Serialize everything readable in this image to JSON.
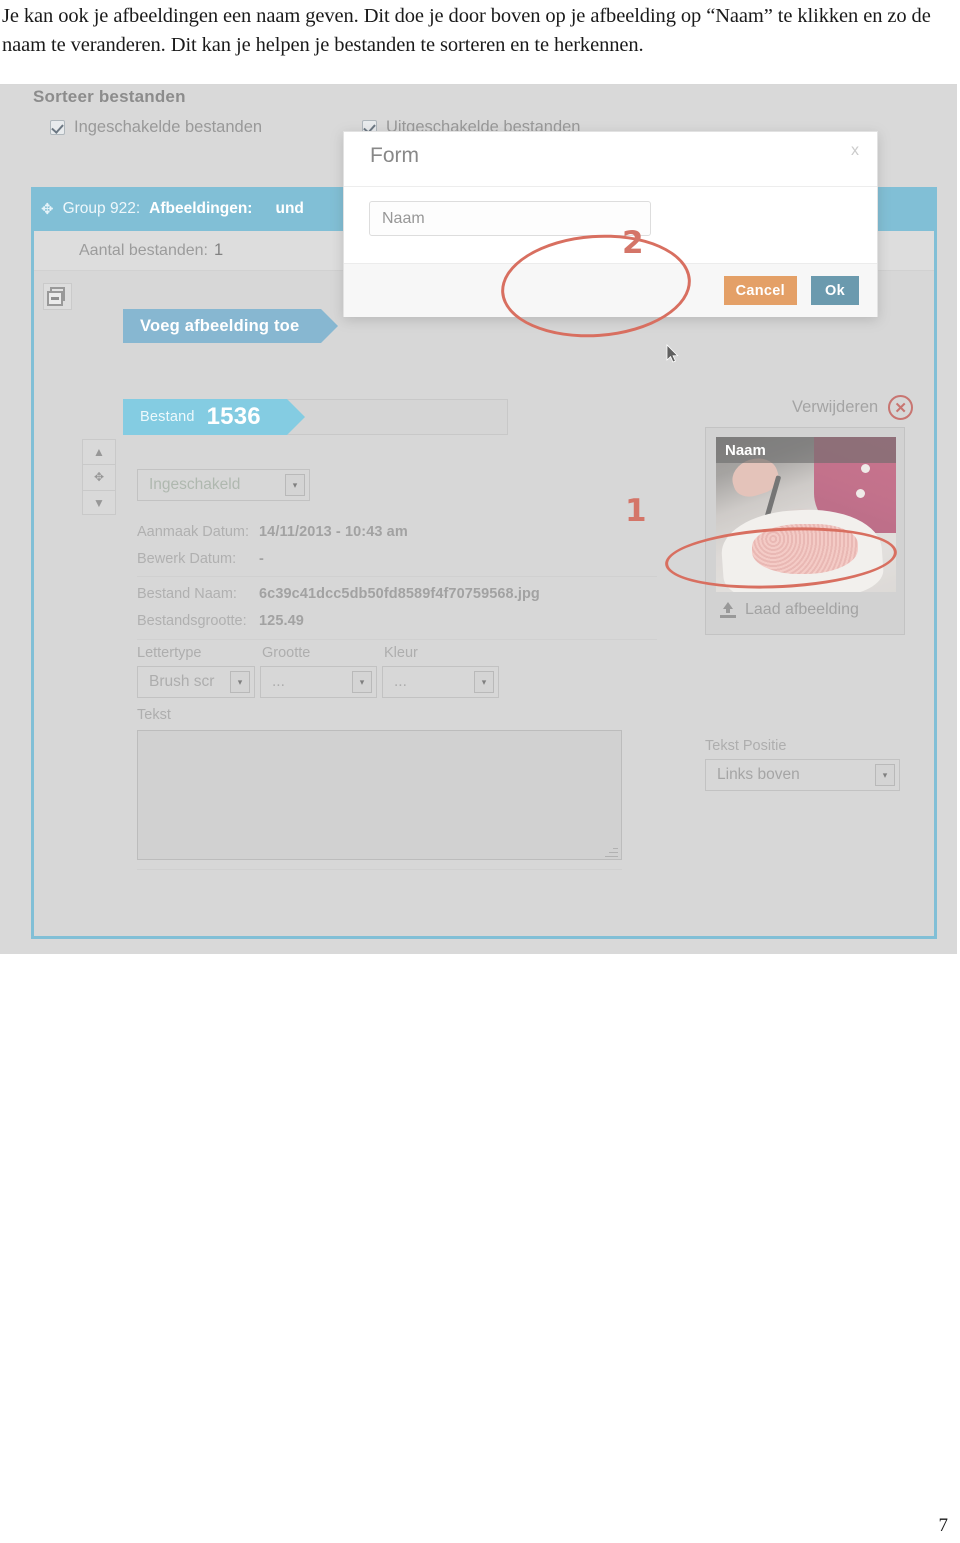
{
  "prose": {
    "paragraph": "Je kan ook je afbeeldingen een naam geven. Dit doe je door boven op je afbeelding op “Naam” te klikken en zo de naam te veranderen. Dit kan je helpen je bestanden te sorteren en te herkennen."
  },
  "page": {
    "number": "7"
  },
  "screenshot": {
    "sort_section": {
      "title": "Sorteer bestanden",
      "checkboxes": [
        {
          "label": "Ingeschakelde bestanden",
          "checked": true
        },
        {
          "label": "Uitgeschakelde bestanden",
          "checked": true
        }
      ]
    },
    "group_header": {
      "move_icon": "✥",
      "prefix": "Group 922:",
      "type": "Afbeeldingen:",
      "value": "und"
    },
    "count_row": {
      "label": "Aantal bestanden:",
      "value": "1"
    },
    "collapse_icon": "minus-icon",
    "add_image_tag": "Voeg afbeelding toe",
    "file_tag": {
      "label": "Bestand",
      "number": "1536"
    },
    "order_controls": {
      "up": "▲",
      "move": "✥",
      "down": "▼"
    },
    "status_select": {
      "value": "Ingeschakeld",
      "arrow": "▾"
    },
    "meta": [
      {
        "key": "Aanmaak Datum:",
        "value": "14/11/2013 - 10:43 am"
      },
      {
        "key": "Bewerk Datum:",
        "value": "-"
      },
      {
        "key": "Bestand Naam:",
        "value": "6c39c41dcc5db50fd8589f4f70759568.jpg"
      },
      {
        "key": "Bestandsgrootte:",
        "value": "125.49"
      }
    ],
    "font_controls": [
      {
        "label": "Lettertype",
        "value": "Brush scr"
      },
      {
        "label": "Grootte",
        "value": "..."
      },
      {
        "label": "Kleur",
        "value": "..."
      }
    ],
    "text_field": {
      "label": "Tekst",
      "value": ""
    },
    "right_panel": {
      "delete_label": "Verwijderen",
      "delete_icon": "circle-x-icon",
      "thumbnail_name_overlay": "Naam",
      "upload_label": "Laad afbeelding",
      "upload_icon": "upload-icon",
      "text_position": {
        "label": "Tekst Positie",
        "value": "Links boven",
        "arrow": "▾"
      }
    }
  },
  "modal": {
    "title": "Form",
    "close_label": "x",
    "input_value": "Naam",
    "cancel_label": "Cancel",
    "ok_label": "Ok"
  },
  "annotations": {
    "marker_one": "1",
    "marker_two": "2"
  },
  "colors": {
    "accent_blue": "#4ba4c4",
    "file_tag_blue": "#4fb7d6",
    "cancel_orange": "#d97826",
    "ok_blue": "#2b6f8c",
    "annotation_red": "#c8311c"
  }
}
